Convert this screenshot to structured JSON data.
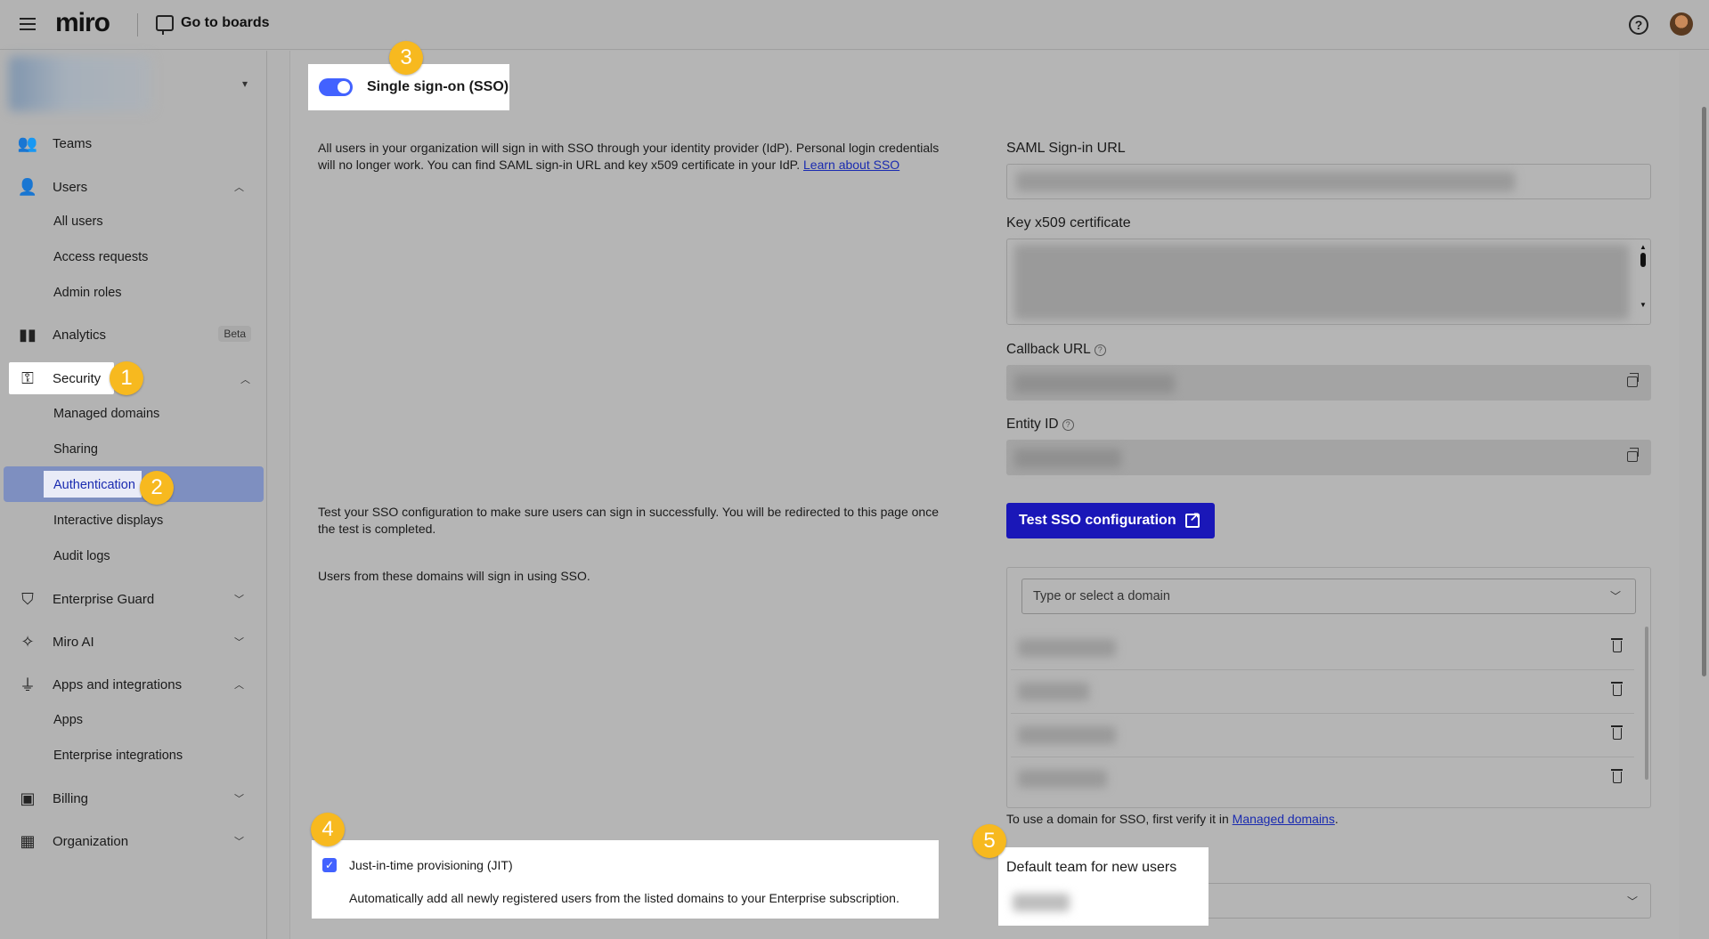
{
  "topbar": {
    "logo": "miro",
    "goto_boards": "Go to boards"
  },
  "sidebar": {
    "items": [
      {
        "label": "Teams"
      },
      {
        "label": "Users"
      },
      {
        "label": "All users"
      },
      {
        "label": "Access requests"
      },
      {
        "label": "Admin roles"
      },
      {
        "label": "Analytics",
        "badge": "Beta"
      },
      {
        "label": "Security"
      },
      {
        "label": "Managed domains"
      },
      {
        "label": "Sharing"
      },
      {
        "label": "Authentication"
      },
      {
        "label": "Interactive displays"
      },
      {
        "label": "Audit logs"
      },
      {
        "label": "Enterprise Guard"
      },
      {
        "label": "Miro AI"
      },
      {
        "label": "Apps and integrations"
      },
      {
        "label": "Apps"
      },
      {
        "label": "Enterprise integrations"
      },
      {
        "label": "Billing"
      },
      {
        "label": "Organization"
      }
    ]
  },
  "badges": [
    "1",
    "2",
    "3",
    "4",
    "5"
  ],
  "sso": {
    "toggle_label": "Single sign-on (SSO)",
    "enabled": true,
    "description_line1": "All users in your organization will sign in with SSO through your identity provider (IdP). Personal login credentials",
    "description_line2": "will no longer work. You can find SAML sign-in URL and key x509 certificate in your IdP. ",
    "learn_link": "Learn about SSO",
    "saml_label": "SAML Sign-in URL",
    "cert_label": "Key x509 certificate",
    "callback_label": "Callback URL",
    "entity_label": "Entity ID",
    "test_description_line1": "Test your SSO configuration to make sure users can sign in successfully. You will be redirected to this page once",
    "test_description_line2": "the test is completed.",
    "test_button": "Test SSO configuration",
    "domains_description": "Users from these domains will sign in using SSO.",
    "domain_placeholder": "Type or select a domain",
    "domain_note_prefix": "To use a domain for SSO, first verify it in ",
    "domain_note_link": "Managed domains",
    "domain_note_suffix": "."
  },
  "jit": {
    "label": "Just-in-time provisioning (JIT)",
    "checked": true,
    "description": "Automatically add all newly registered users from the listed domains to your Enterprise subscription."
  },
  "default_team": {
    "label": "Default team for new users"
  },
  "colors": {
    "accent": "#4262ff",
    "button": "#1a17b8",
    "badge": "#f7b91f",
    "link": "#1a2bb0"
  }
}
